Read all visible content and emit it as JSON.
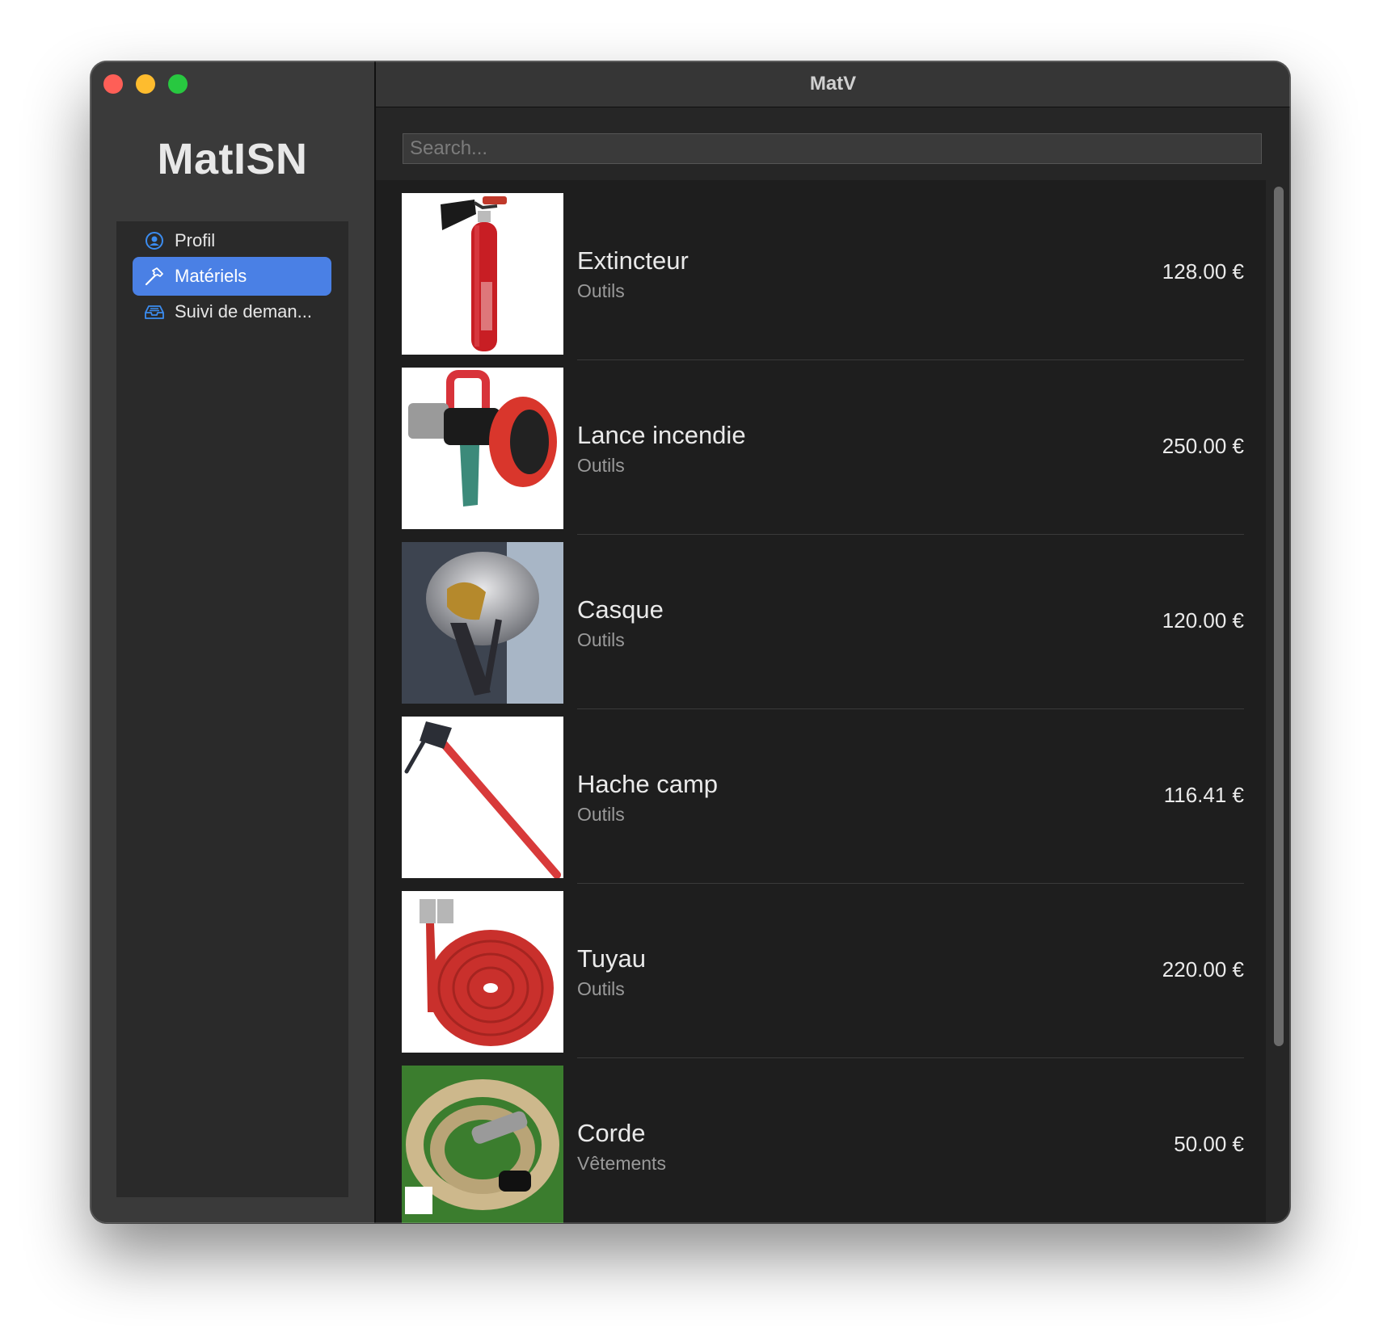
{
  "sidebar": {
    "app_title": "MatISN",
    "items": [
      {
        "label": "Profil",
        "icon": "person-circle-icon",
        "active": false
      },
      {
        "label": "Matériels",
        "icon": "hammer-icon",
        "active": true
      },
      {
        "label": "Suivi de deman...",
        "icon": "tray-icon",
        "active": false
      }
    ]
  },
  "main": {
    "window_title": "MatV",
    "search": {
      "value": "",
      "placeholder": "Search..."
    },
    "items": [
      {
        "name": "Extincteur",
        "category": "Outils",
        "price": "128.00 €",
        "image": "extinguisher-image"
      },
      {
        "name": "Lance incendie",
        "category": "Outils",
        "price": "250.00 €",
        "image": "fire-nozzle-image"
      },
      {
        "name": "Casque",
        "category": "Outils",
        "price": "120.00 €",
        "image": "helmet-image"
      },
      {
        "name": "Hache camp",
        "category": "Outils",
        "price": "116.41 €",
        "image": "axe-image"
      },
      {
        "name": "Tuyau",
        "category": "Outils",
        "price": "220.00 €",
        "image": "hose-image"
      },
      {
        "name": "Corde",
        "category": "Vêtements",
        "price": "50.00 €",
        "image": "rope-image"
      }
    ]
  },
  "colors": {
    "accent": "#4a80e5",
    "close": "#fe5f57",
    "minimize": "#febc2e",
    "maximize": "#28c840"
  }
}
